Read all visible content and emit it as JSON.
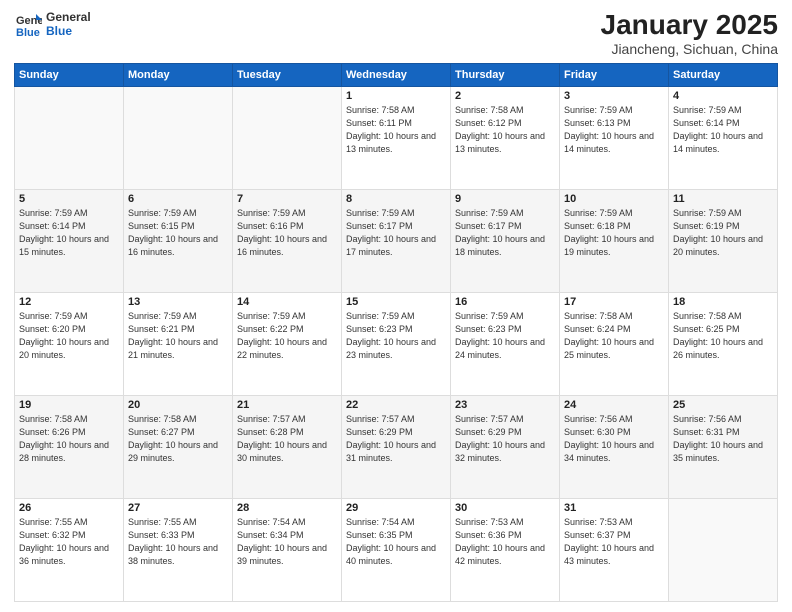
{
  "logo": {
    "general": "General",
    "blue": "Blue"
  },
  "header": {
    "month": "January 2025",
    "location": "Jiancheng, Sichuan, China"
  },
  "days_of_week": [
    "Sunday",
    "Monday",
    "Tuesday",
    "Wednesday",
    "Thursday",
    "Friday",
    "Saturday"
  ],
  "weeks": [
    [
      {
        "num": "",
        "info": ""
      },
      {
        "num": "",
        "info": ""
      },
      {
        "num": "",
        "info": ""
      },
      {
        "num": "1",
        "info": "Sunrise: 7:58 AM\nSunset: 6:11 PM\nDaylight: 10 hours\nand 13 minutes."
      },
      {
        "num": "2",
        "info": "Sunrise: 7:58 AM\nSunset: 6:12 PM\nDaylight: 10 hours\nand 13 minutes."
      },
      {
        "num": "3",
        "info": "Sunrise: 7:59 AM\nSunset: 6:13 PM\nDaylight: 10 hours\nand 14 minutes."
      },
      {
        "num": "4",
        "info": "Sunrise: 7:59 AM\nSunset: 6:14 PM\nDaylight: 10 hours\nand 14 minutes."
      }
    ],
    [
      {
        "num": "5",
        "info": "Sunrise: 7:59 AM\nSunset: 6:14 PM\nDaylight: 10 hours\nand 15 minutes."
      },
      {
        "num": "6",
        "info": "Sunrise: 7:59 AM\nSunset: 6:15 PM\nDaylight: 10 hours\nand 16 minutes."
      },
      {
        "num": "7",
        "info": "Sunrise: 7:59 AM\nSunset: 6:16 PM\nDaylight: 10 hours\nand 16 minutes."
      },
      {
        "num": "8",
        "info": "Sunrise: 7:59 AM\nSunset: 6:17 PM\nDaylight: 10 hours\nand 17 minutes."
      },
      {
        "num": "9",
        "info": "Sunrise: 7:59 AM\nSunset: 6:17 PM\nDaylight: 10 hours\nand 18 minutes."
      },
      {
        "num": "10",
        "info": "Sunrise: 7:59 AM\nSunset: 6:18 PM\nDaylight: 10 hours\nand 19 minutes."
      },
      {
        "num": "11",
        "info": "Sunrise: 7:59 AM\nSunset: 6:19 PM\nDaylight: 10 hours\nand 20 minutes."
      }
    ],
    [
      {
        "num": "12",
        "info": "Sunrise: 7:59 AM\nSunset: 6:20 PM\nDaylight: 10 hours\nand 20 minutes."
      },
      {
        "num": "13",
        "info": "Sunrise: 7:59 AM\nSunset: 6:21 PM\nDaylight: 10 hours\nand 21 minutes."
      },
      {
        "num": "14",
        "info": "Sunrise: 7:59 AM\nSunset: 6:22 PM\nDaylight: 10 hours\nand 22 minutes."
      },
      {
        "num": "15",
        "info": "Sunrise: 7:59 AM\nSunset: 6:23 PM\nDaylight: 10 hours\nand 23 minutes."
      },
      {
        "num": "16",
        "info": "Sunrise: 7:59 AM\nSunset: 6:23 PM\nDaylight: 10 hours\nand 24 minutes."
      },
      {
        "num": "17",
        "info": "Sunrise: 7:58 AM\nSunset: 6:24 PM\nDaylight: 10 hours\nand 25 minutes."
      },
      {
        "num": "18",
        "info": "Sunrise: 7:58 AM\nSunset: 6:25 PM\nDaylight: 10 hours\nand 26 minutes."
      }
    ],
    [
      {
        "num": "19",
        "info": "Sunrise: 7:58 AM\nSunset: 6:26 PM\nDaylight: 10 hours\nand 28 minutes."
      },
      {
        "num": "20",
        "info": "Sunrise: 7:58 AM\nSunset: 6:27 PM\nDaylight: 10 hours\nand 29 minutes."
      },
      {
        "num": "21",
        "info": "Sunrise: 7:57 AM\nSunset: 6:28 PM\nDaylight: 10 hours\nand 30 minutes."
      },
      {
        "num": "22",
        "info": "Sunrise: 7:57 AM\nSunset: 6:29 PM\nDaylight: 10 hours\nand 31 minutes."
      },
      {
        "num": "23",
        "info": "Sunrise: 7:57 AM\nSunset: 6:29 PM\nDaylight: 10 hours\nand 32 minutes."
      },
      {
        "num": "24",
        "info": "Sunrise: 7:56 AM\nSunset: 6:30 PM\nDaylight: 10 hours\nand 34 minutes."
      },
      {
        "num": "25",
        "info": "Sunrise: 7:56 AM\nSunset: 6:31 PM\nDaylight: 10 hours\nand 35 minutes."
      }
    ],
    [
      {
        "num": "26",
        "info": "Sunrise: 7:55 AM\nSunset: 6:32 PM\nDaylight: 10 hours\nand 36 minutes."
      },
      {
        "num": "27",
        "info": "Sunrise: 7:55 AM\nSunset: 6:33 PM\nDaylight: 10 hours\nand 38 minutes."
      },
      {
        "num": "28",
        "info": "Sunrise: 7:54 AM\nSunset: 6:34 PM\nDaylight: 10 hours\nand 39 minutes."
      },
      {
        "num": "29",
        "info": "Sunrise: 7:54 AM\nSunset: 6:35 PM\nDaylight: 10 hours\nand 40 minutes."
      },
      {
        "num": "30",
        "info": "Sunrise: 7:53 AM\nSunset: 6:36 PM\nDaylight: 10 hours\nand 42 minutes."
      },
      {
        "num": "31",
        "info": "Sunrise: 7:53 AM\nSunset: 6:37 PM\nDaylight: 10 hours\nand 43 minutes."
      },
      {
        "num": "",
        "info": ""
      }
    ]
  ]
}
